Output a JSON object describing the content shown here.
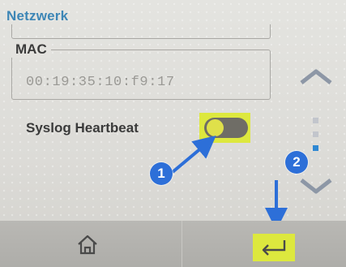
{
  "header": {
    "title": "Netzwerk"
  },
  "mac": {
    "label": "MAC",
    "value": "00:19:35:10:f9:17"
  },
  "syslog": {
    "label": "Syslog Heartbeat",
    "toggle_on": false
  },
  "annotations": {
    "badge1": "1",
    "badge2": "2",
    "highlight_color": "#dde83e",
    "badge_color": "#2d6fd8"
  },
  "scroll": {
    "up_icon": "chevron-up-icon",
    "down_icon": "chevron-down-icon"
  },
  "footer": {
    "home_icon": "home-icon",
    "back_icon": "enter-return-icon"
  }
}
